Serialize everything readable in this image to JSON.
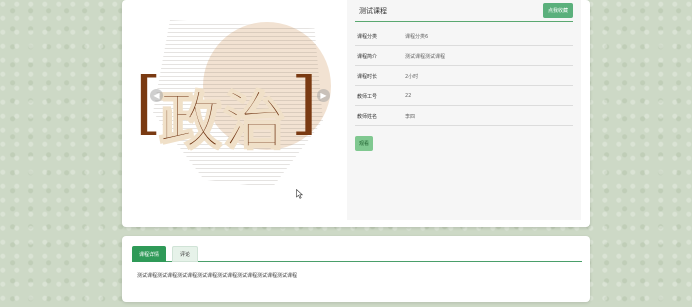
{
  "banner": {
    "title": "政治",
    "bracket_left": "[",
    "bracket_right": "]",
    "prev_icon": "chevron-left-icon",
    "next_icon": "chevron-right-icon"
  },
  "course": {
    "name": "测试课程",
    "favorite_button": "点我收藏",
    "fields": [
      {
        "label": "课程分类",
        "value": "课程分类6"
      },
      {
        "label": "课程简介",
        "value": "测试课程测试课程"
      },
      {
        "label": "课程时长",
        "value": "2小时"
      },
      {
        "label": "教师工号",
        "value": "22"
      },
      {
        "label": "教师姓名",
        "value": "李四"
      }
    ],
    "watch_button": "观看"
  },
  "tabs": [
    {
      "label": "课程详情",
      "active": true
    },
    {
      "label": "评论",
      "active": false
    }
  ],
  "detail_text": "测试课程测试课程测试课程测试课程测试课程测试课程测试课程测试课程",
  "colors": {
    "accent": "#2f9a58",
    "button": "#5bb07c",
    "title_brown": "#6b2e0c"
  }
}
